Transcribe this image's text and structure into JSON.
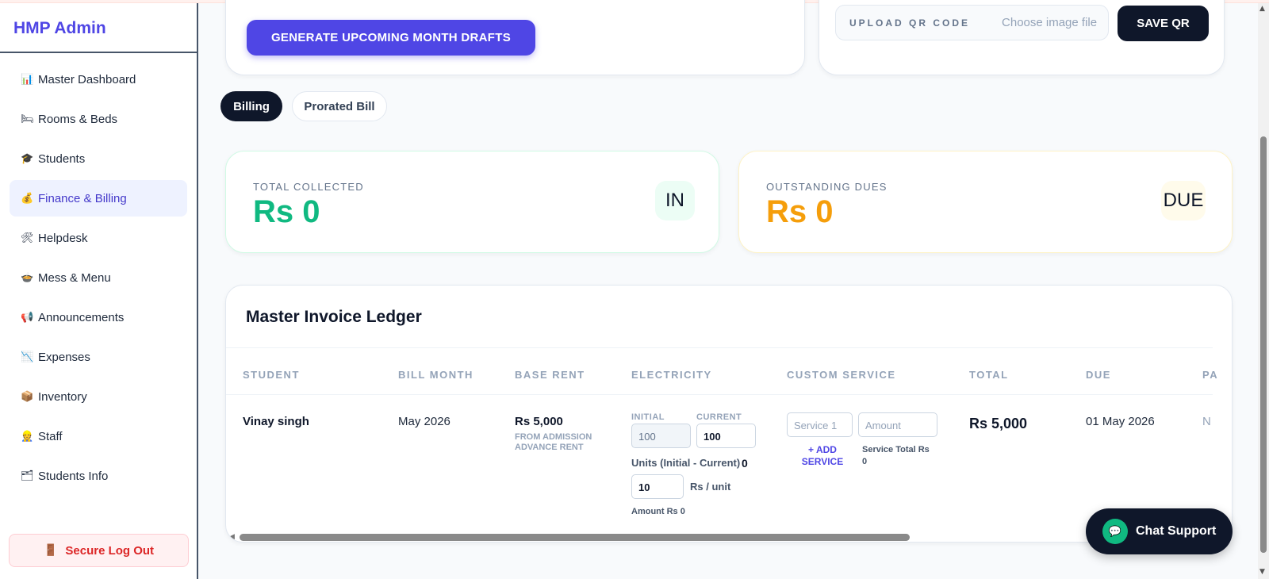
{
  "app": {
    "title": "HMP Admin"
  },
  "sidebar": {
    "items": [
      {
        "icon": "📊",
        "label": "Master Dashboard"
      },
      {
        "icon": "🛏",
        "label": "Rooms & Beds"
      },
      {
        "icon": "🎓",
        "label": "Students"
      },
      {
        "icon": "💰",
        "label": "Finance & Billing"
      },
      {
        "icon": "🛠",
        "label": "Helpdesk"
      },
      {
        "icon": "🍲",
        "label": "Mess & Menu"
      },
      {
        "icon": "📢",
        "label": "Announcements"
      },
      {
        "icon": "📉",
        "label": "Expenses"
      },
      {
        "icon": "📦",
        "label": "Inventory"
      },
      {
        "icon": "👷",
        "label": "Staff"
      },
      {
        "icon": "🗂",
        "label": "Students Info"
      }
    ],
    "logout": {
      "icon": "🚪",
      "label": "Secure Log Out"
    }
  },
  "actions": {
    "generate_label": "GENERATE UPCOMING MONTH DRAFTS",
    "qr_label": "UPLOAD QR CODE",
    "qr_file_placeholder": "Choose image file",
    "save_qr_label": "SAVE QR"
  },
  "tabs": [
    {
      "label": "Billing",
      "active": true
    },
    {
      "label": "Prorated Bill",
      "active": false
    }
  ],
  "stats": {
    "collected": {
      "label": "TOTAL COLLECTED",
      "value": "Rs 0",
      "badge": "IN",
      "color": "#10b981"
    },
    "dues": {
      "label": "OUTSTANDING DUES",
      "value": "Rs 0",
      "badge": "DUE",
      "color": "#f59e0b"
    }
  },
  "ledger": {
    "title": "Master Invoice Ledger",
    "columns": [
      "STUDENT",
      "BILL MONTH",
      "BASE RENT",
      "ELECTRICITY",
      "CUSTOM SERVICE",
      "TOTAL",
      "DUE",
      "PA"
    ],
    "rows": [
      {
        "student": "Vinay singh",
        "bill_month": "May 2026",
        "base_rent": "Rs 5,000",
        "base_rent_note": "FROM ADMISSION ADVANCE RENT",
        "electricity": {
          "initial_label": "INITIAL",
          "initial_value": "100",
          "current_label": "CURRENT",
          "current_value": "100",
          "units_label": "Units (Initial - Current)",
          "units_value": "0",
          "rate_value": "10",
          "rate_label": "Rs / unit",
          "amount_label": "Amount Rs 0"
        },
        "custom_service": {
          "service_placeholder": "Service 1",
          "amount_placeholder": "Amount",
          "add_label": "+ ADD SERVICE",
          "total_label": "Service Total Rs",
          "total_value": "0"
        },
        "total": "Rs 5,000",
        "due": "01 May 2026",
        "partial": "N"
      }
    ]
  },
  "chat": {
    "label": "Chat Support",
    "icon": "💬"
  }
}
